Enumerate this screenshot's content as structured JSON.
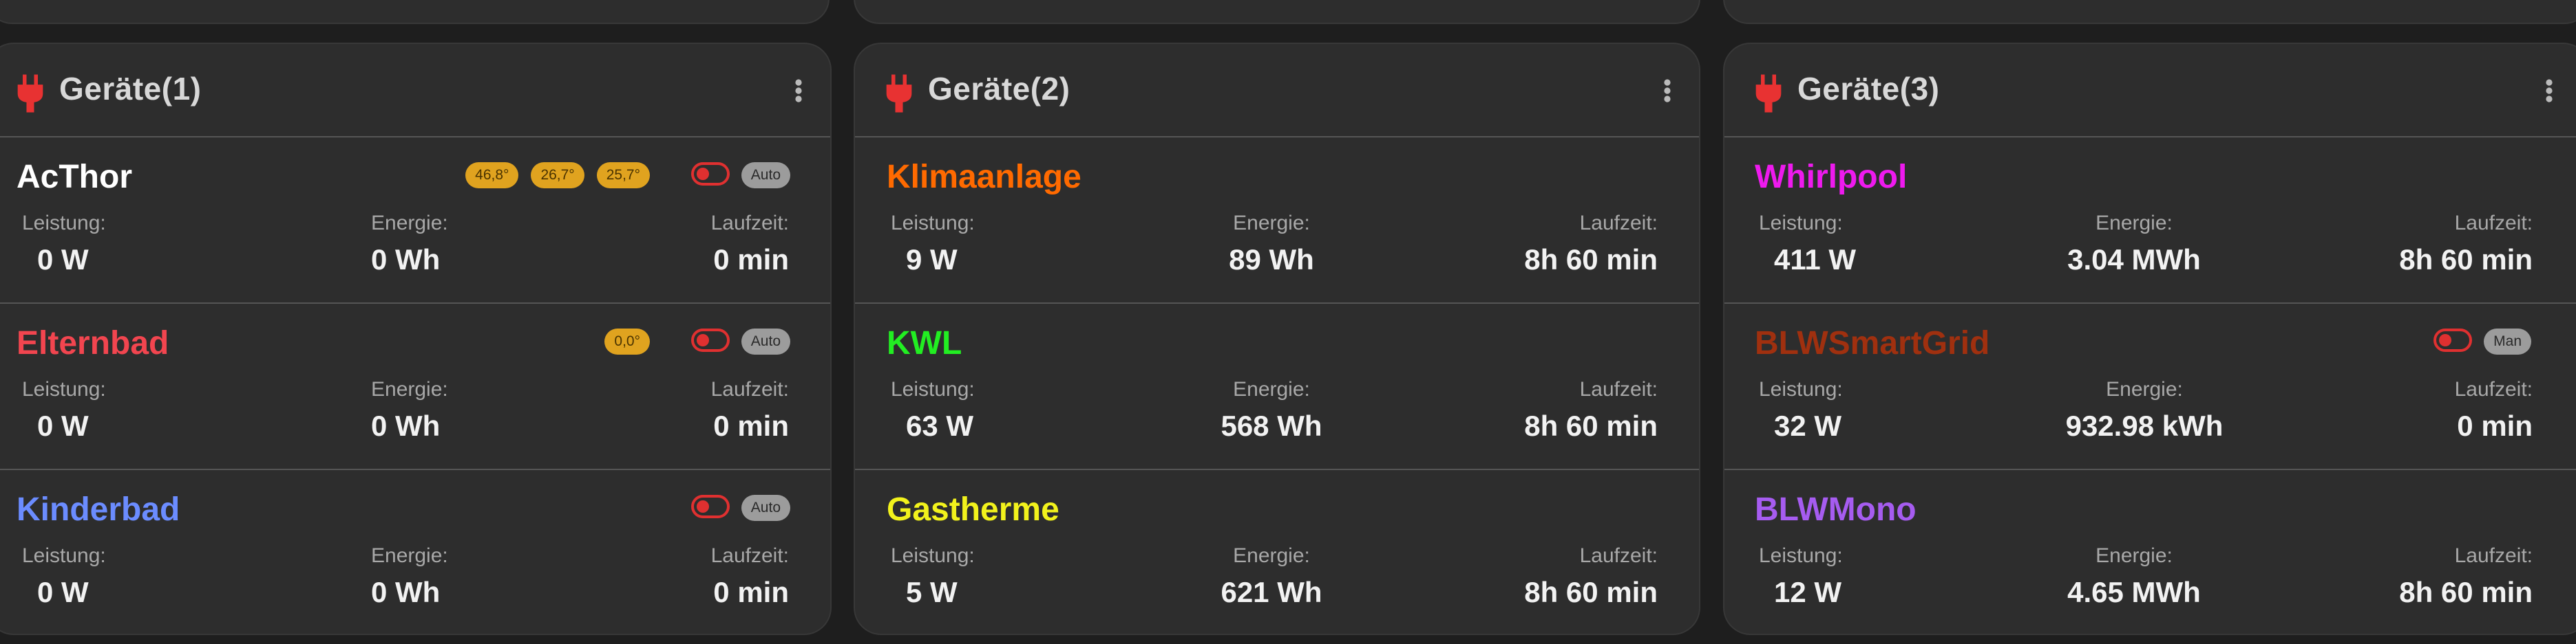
{
  "cards": [
    {
      "title": "Geräte(1)",
      "devices": [
        {
          "name": "AcThor",
          "color": "#ffffff",
          "badges": [
            "46,8°",
            "26,7°",
            "25,7°"
          ],
          "toggle": true,
          "mode": "Auto",
          "power_label": "Leistung:",
          "power": "0 W",
          "energy_label": "Energie:",
          "energy": "0 Wh",
          "runtime_label": "Laufzeit:",
          "runtime": "0 min"
        },
        {
          "name": "Elternbad",
          "color": "#f2454f",
          "badges": [
            "0,0°"
          ],
          "toggle": true,
          "mode": "Auto",
          "power_label": "Leistung:",
          "power": "0 W",
          "energy_label": "Energie:",
          "energy": "0 Wh",
          "runtime_label": "Laufzeit:",
          "runtime": "0 min"
        },
        {
          "name": "Kinderbad",
          "color": "#6b8cff",
          "badges": [],
          "toggle": true,
          "mode": "Auto",
          "power_label": "Leistung:",
          "power": "0 W",
          "energy_label": "Energie:",
          "energy": "0 Wh",
          "runtime_label": "Laufzeit:",
          "runtime": "0 min"
        }
      ]
    },
    {
      "title": "Geräte(2)",
      "devices": [
        {
          "name": "Klimaanlage",
          "color": "#ff6a00",
          "badges": [],
          "toggle": false,
          "mode": "",
          "power_label": "Leistung:",
          "power": "9 W",
          "energy_label": "Energie:",
          "energy": "89 Wh",
          "runtime_label": "Laufzeit:",
          "runtime": "8h 60 min"
        },
        {
          "name": "KWL",
          "color": "#22ee22",
          "badges": [],
          "toggle": false,
          "mode": "",
          "power_label": "Leistung:",
          "power": "63 W",
          "energy_label": "Energie:",
          "energy": "568 Wh",
          "runtime_label": "Laufzeit:",
          "runtime": "8h 60 min"
        },
        {
          "name": "Gastherme",
          "color": "#f2f21c",
          "badges": [],
          "toggle": false,
          "mode": "",
          "power_label": "Leistung:",
          "power": "5 W",
          "energy_label": "Energie:",
          "energy": "621 Wh",
          "runtime_label": "Laufzeit:",
          "runtime": "8h 60 min"
        }
      ]
    },
    {
      "title": "Geräte(3)",
      "devices": [
        {
          "name": "Whirlpool",
          "color": "#ee1aee",
          "badges": [],
          "toggle": false,
          "mode": "",
          "power_label": "Leistung:",
          "power": "411 W",
          "energy_label": "Energie:",
          "energy": "3.04 MWh",
          "runtime_label": "Laufzeit:",
          "runtime": "8h 60 min"
        },
        {
          "name": "BLWSmartGrid",
          "color": "#a0300f",
          "badges": [],
          "toggle": true,
          "mode": "Man",
          "power_label": "Leistung:",
          "power": "32 W",
          "energy_label": "Energie:",
          "energy": "932.98 kWh",
          "runtime_label": "Laufzeit:",
          "runtime": "0 min"
        },
        {
          "name": "BLWMono",
          "color": "#a65cf0",
          "badges": [],
          "toggle": false,
          "mode": "",
          "power_label": "Leistung:",
          "power": "12 W",
          "energy_label": "Energie:",
          "energy": "4.65 MWh",
          "runtime_label": "Laufzeit:",
          "runtime": "8h 60 min"
        }
      ]
    }
  ],
  "colors": {
    "plug_icon": "#e83232",
    "toggle": "#e03030",
    "badge": "#e0a31f"
  },
  "icons": {
    "header": "plug-icon",
    "menu": "more-vert-icon"
  }
}
